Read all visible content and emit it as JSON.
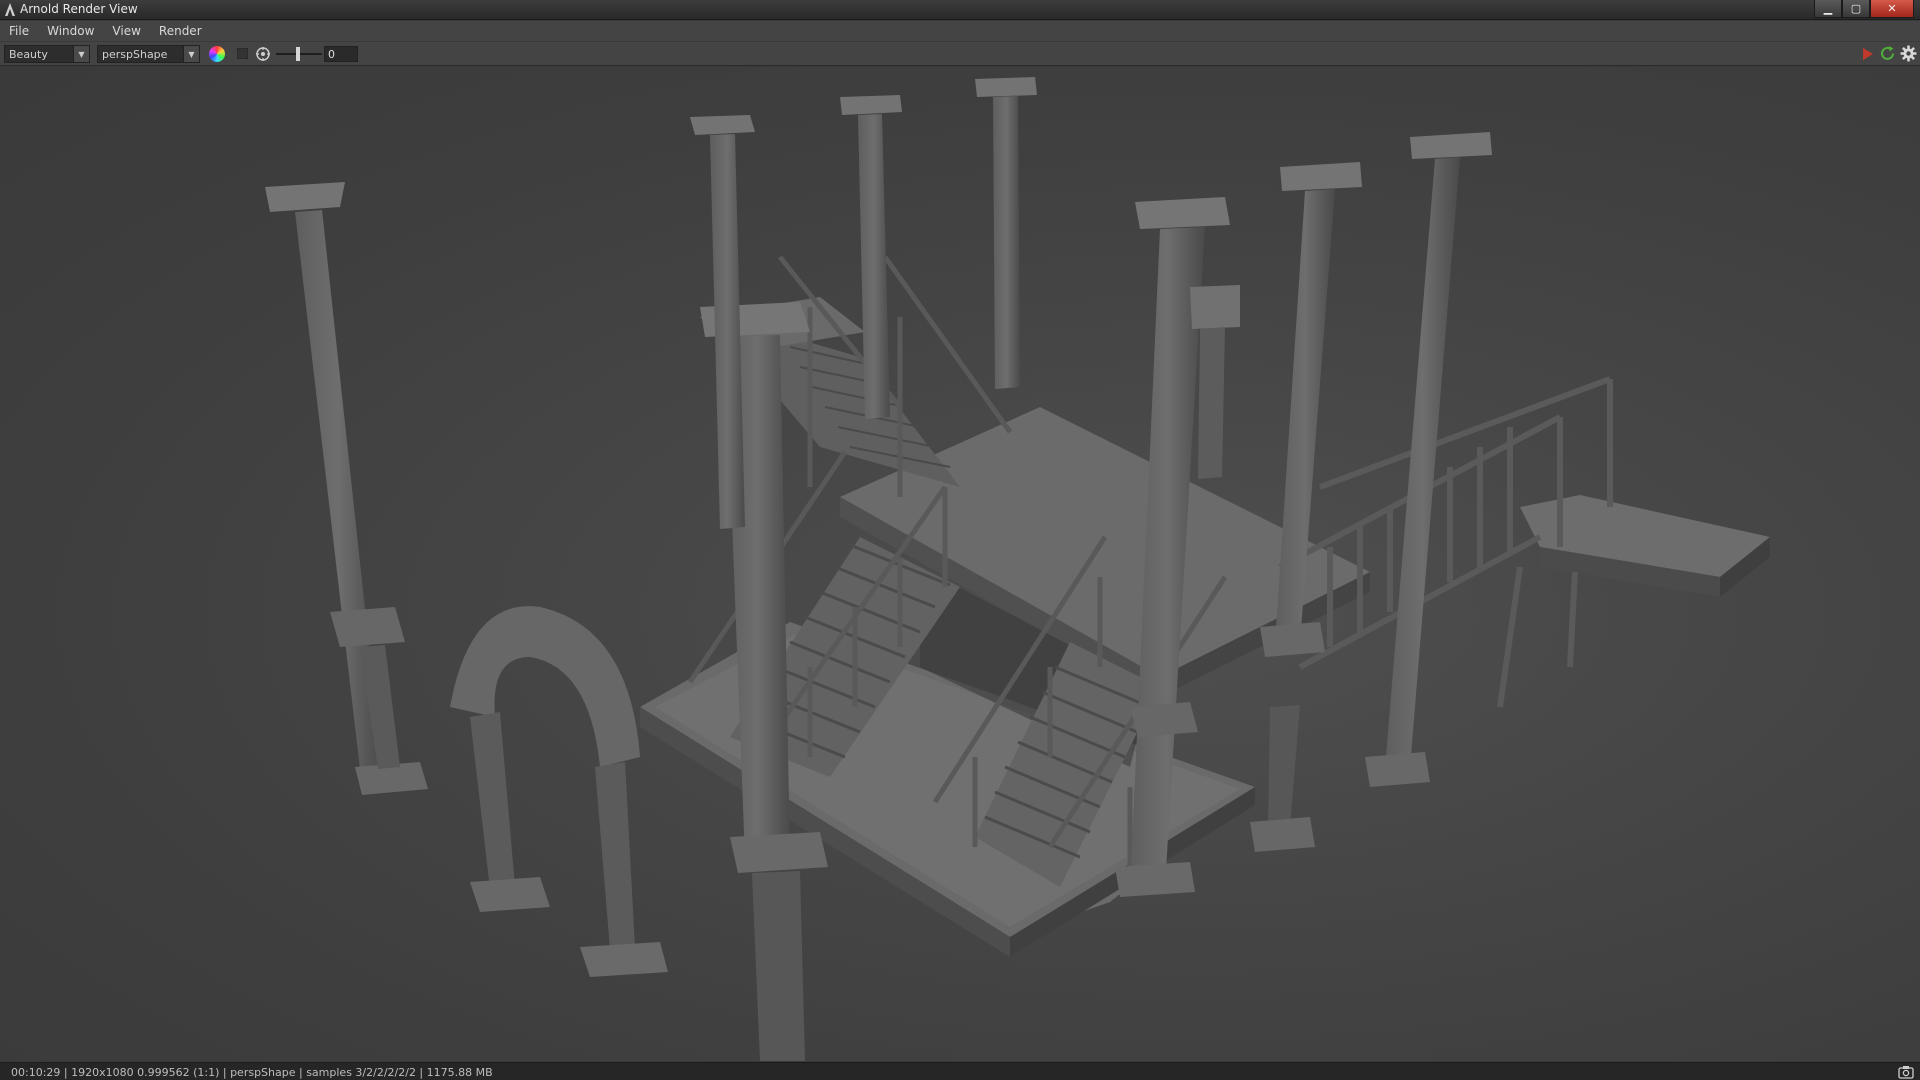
{
  "window": {
    "title": "Arnold Render View",
    "icon": "arnold-a-icon"
  },
  "window_controls": {
    "minimize": "minimize-icon",
    "maximize": "maximize-icon",
    "close": "close-icon"
  },
  "menu": {
    "items": [
      "File",
      "Window",
      "View",
      "Render"
    ]
  },
  "toolbar": {
    "aov_value": "Beauty",
    "camera_value": "perspShape",
    "exposure_value": "0",
    "icons": [
      "color-channels-icon",
      "exposure-icon",
      "render-play-icon",
      "refresh-render-icon",
      "gear-icon"
    ],
    "accent_render": "#c0392b",
    "accent_refresh": "#4fae3a"
  },
  "status": {
    "text": "00:10:29 | 1920x1080 0.999562 (1:1) | perspShape  | samples 3/2/2/2/2/2 | 1175.88 MB",
    "snapshot_icon": "camera-snapshot-icon"
  },
  "viewport": {
    "content": "render-image-architecture",
    "background": "#454545"
  }
}
